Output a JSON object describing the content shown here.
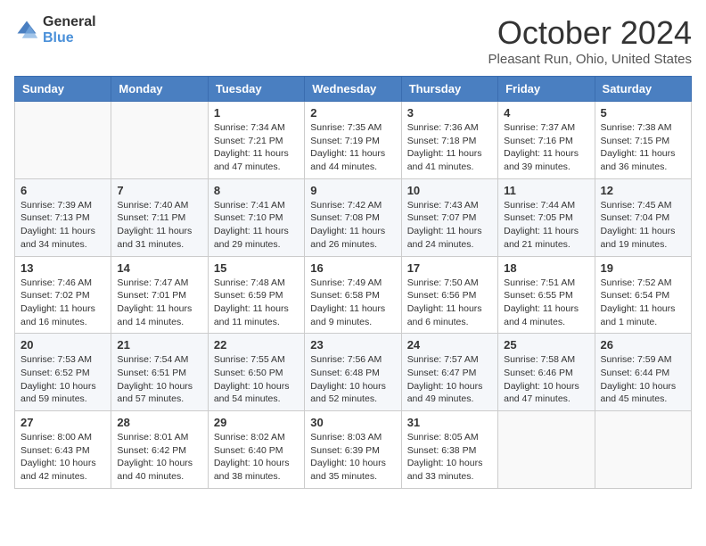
{
  "logo": {
    "general": "General",
    "blue": "Blue"
  },
  "title": "October 2024",
  "location": "Pleasant Run, Ohio, United States",
  "days_header": [
    "Sunday",
    "Monday",
    "Tuesday",
    "Wednesday",
    "Thursday",
    "Friday",
    "Saturday"
  ],
  "weeks": [
    [
      {
        "day": "",
        "info": ""
      },
      {
        "day": "",
        "info": ""
      },
      {
        "day": "1",
        "info": "Sunrise: 7:34 AM\nSunset: 7:21 PM\nDaylight: 11 hours and 47 minutes."
      },
      {
        "day": "2",
        "info": "Sunrise: 7:35 AM\nSunset: 7:19 PM\nDaylight: 11 hours and 44 minutes."
      },
      {
        "day": "3",
        "info": "Sunrise: 7:36 AM\nSunset: 7:18 PM\nDaylight: 11 hours and 41 minutes."
      },
      {
        "day": "4",
        "info": "Sunrise: 7:37 AM\nSunset: 7:16 PM\nDaylight: 11 hours and 39 minutes."
      },
      {
        "day": "5",
        "info": "Sunrise: 7:38 AM\nSunset: 7:15 PM\nDaylight: 11 hours and 36 minutes."
      }
    ],
    [
      {
        "day": "6",
        "info": "Sunrise: 7:39 AM\nSunset: 7:13 PM\nDaylight: 11 hours and 34 minutes."
      },
      {
        "day": "7",
        "info": "Sunrise: 7:40 AM\nSunset: 7:11 PM\nDaylight: 11 hours and 31 minutes."
      },
      {
        "day": "8",
        "info": "Sunrise: 7:41 AM\nSunset: 7:10 PM\nDaylight: 11 hours and 29 minutes."
      },
      {
        "day": "9",
        "info": "Sunrise: 7:42 AM\nSunset: 7:08 PM\nDaylight: 11 hours and 26 minutes."
      },
      {
        "day": "10",
        "info": "Sunrise: 7:43 AM\nSunset: 7:07 PM\nDaylight: 11 hours and 24 minutes."
      },
      {
        "day": "11",
        "info": "Sunrise: 7:44 AM\nSunset: 7:05 PM\nDaylight: 11 hours and 21 minutes."
      },
      {
        "day": "12",
        "info": "Sunrise: 7:45 AM\nSunset: 7:04 PM\nDaylight: 11 hours and 19 minutes."
      }
    ],
    [
      {
        "day": "13",
        "info": "Sunrise: 7:46 AM\nSunset: 7:02 PM\nDaylight: 11 hours and 16 minutes."
      },
      {
        "day": "14",
        "info": "Sunrise: 7:47 AM\nSunset: 7:01 PM\nDaylight: 11 hours and 14 minutes."
      },
      {
        "day": "15",
        "info": "Sunrise: 7:48 AM\nSunset: 6:59 PM\nDaylight: 11 hours and 11 minutes."
      },
      {
        "day": "16",
        "info": "Sunrise: 7:49 AM\nSunset: 6:58 PM\nDaylight: 11 hours and 9 minutes."
      },
      {
        "day": "17",
        "info": "Sunrise: 7:50 AM\nSunset: 6:56 PM\nDaylight: 11 hours and 6 minutes."
      },
      {
        "day": "18",
        "info": "Sunrise: 7:51 AM\nSunset: 6:55 PM\nDaylight: 11 hours and 4 minutes."
      },
      {
        "day": "19",
        "info": "Sunrise: 7:52 AM\nSunset: 6:54 PM\nDaylight: 11 hours and 1 minute."
      }
    ],
    [
      {
        "day": "20",
        "info": "Sunrise: 7:53 AM\nSunset: 6:52 PM\nDaylight: 10 hours and 59 minutes."
      },
      {
        "day": "21",
        "info": "Sunrise: 7:54 AM\nSunset: 6:51 PM\nDaylight: 10 hours and 57 minutes."
      },
      {
        "day": "22",
        "info": "Sunrise: 7:55 AM\nSunset: 6:50 PM\nDaylight: 10 hours and 54 minutes."
      },
      {
        "day": "23",
        "info": "Sunrise: 7:56 AM\nSunset: 6:48 PM\nDaylight: 10 hours and 52 minutes."
      },
      {
        "day": "24",
        "info": "Sunrise: 7:57 AM\nSunset: 6:47 PM\nDaylight: 10 hours and 49 minutes."
      },
      {
        "day": "25",
        "info": "Sunrise: 7:58 AM\nSunset: 6:46 PM\nDaylight: 10 hours and 47 minutes."
      },
      {
        "day": "26",
        "info": "Sunrise: 7:59 AM\nSunset: 6:44 PM\nDaylight: 10 hours and 45 minutes."
      }
    ],
    [
      {
        "day": "27",
        "info": "Sunrise: 8:00 AM\nSunset: 6:43 PM\nDaylight: 10 hours and 42 minutes."
      },
      {
        "day": "28",
        "info": "Sunrise: 8:01 AM\nSunset: 6:42 PM\nDaylight: 10 hours and 40 minutes."
      },
      {
        "day": "29",
        "info": "Sunrise: 8:02 AM\nSunset: 6:40 PM\nDaylight: 10 hours and 38 minutes."
      },
      {
        "day": "30",
        "info": "Sunrise: 8:03 AM\nSunset: 6:39 PM\nDaylight: 10 hours and 35 minutes."
      },
      {
        "day": "31",
        "info": "Sunrise: 8:05 AM\nSunset: 6:38 PM\nDaylight: 10 hours and 33 minutes."
      },
      {
        "day": "",
        "info": ""
      },
      {
        "day": "",
        "info": ""
      }
    ]
  ]
}
